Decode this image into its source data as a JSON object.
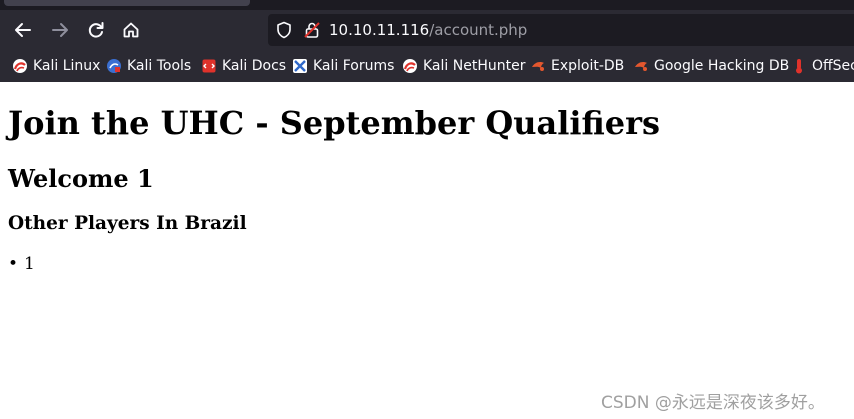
{
  "browser": {
    "url": {
      "host": "10.10.11.116",
      "path": "/account.php"
    },
    "bookmarks": [
      {
        "label": "Kali Linux",
        "icon": "kali-dragon-icon"
      },
      {
        "label": "Kali Tools",
        "icon": "kali-tools-icon"
      },
      {
        "label": "Kali Docs",
        "icon": "kali-docs-icon"
      },
      {
        "label": "Kali Forums",
        "icon": "kali-forums-icon"
      },
      {
        "label": "Kali NetHunter",
        "icon": "kali-dragon-icon"
      },
      {
        "label": "Exploit-DB",
        "icon": "exploit-db-icon"
      },
      {
        "label": "Google Hacking DB",
        "icon": "exploit-db-icon"
      },
      {
        "label": "OffSec",
        "icon": "offsec-icon"
      }
    ]
  },
  "page": {
    "title": "Join the UHC - September Qualifiers",
    "welcome": "Welcome 1",
    "players_heading": "Other Players In Brazil",
    "players": [
      "1"
    ]
  },
  "watermark": "CSDN @永远是深夜该多好。",
  "colors": {
    "toolbar": "#2b2a33",
    "urlbar": "#1c1b22",
    "kali_red": "#e0322b",
    "exploit_orange": "#e4572e"
  }
}
